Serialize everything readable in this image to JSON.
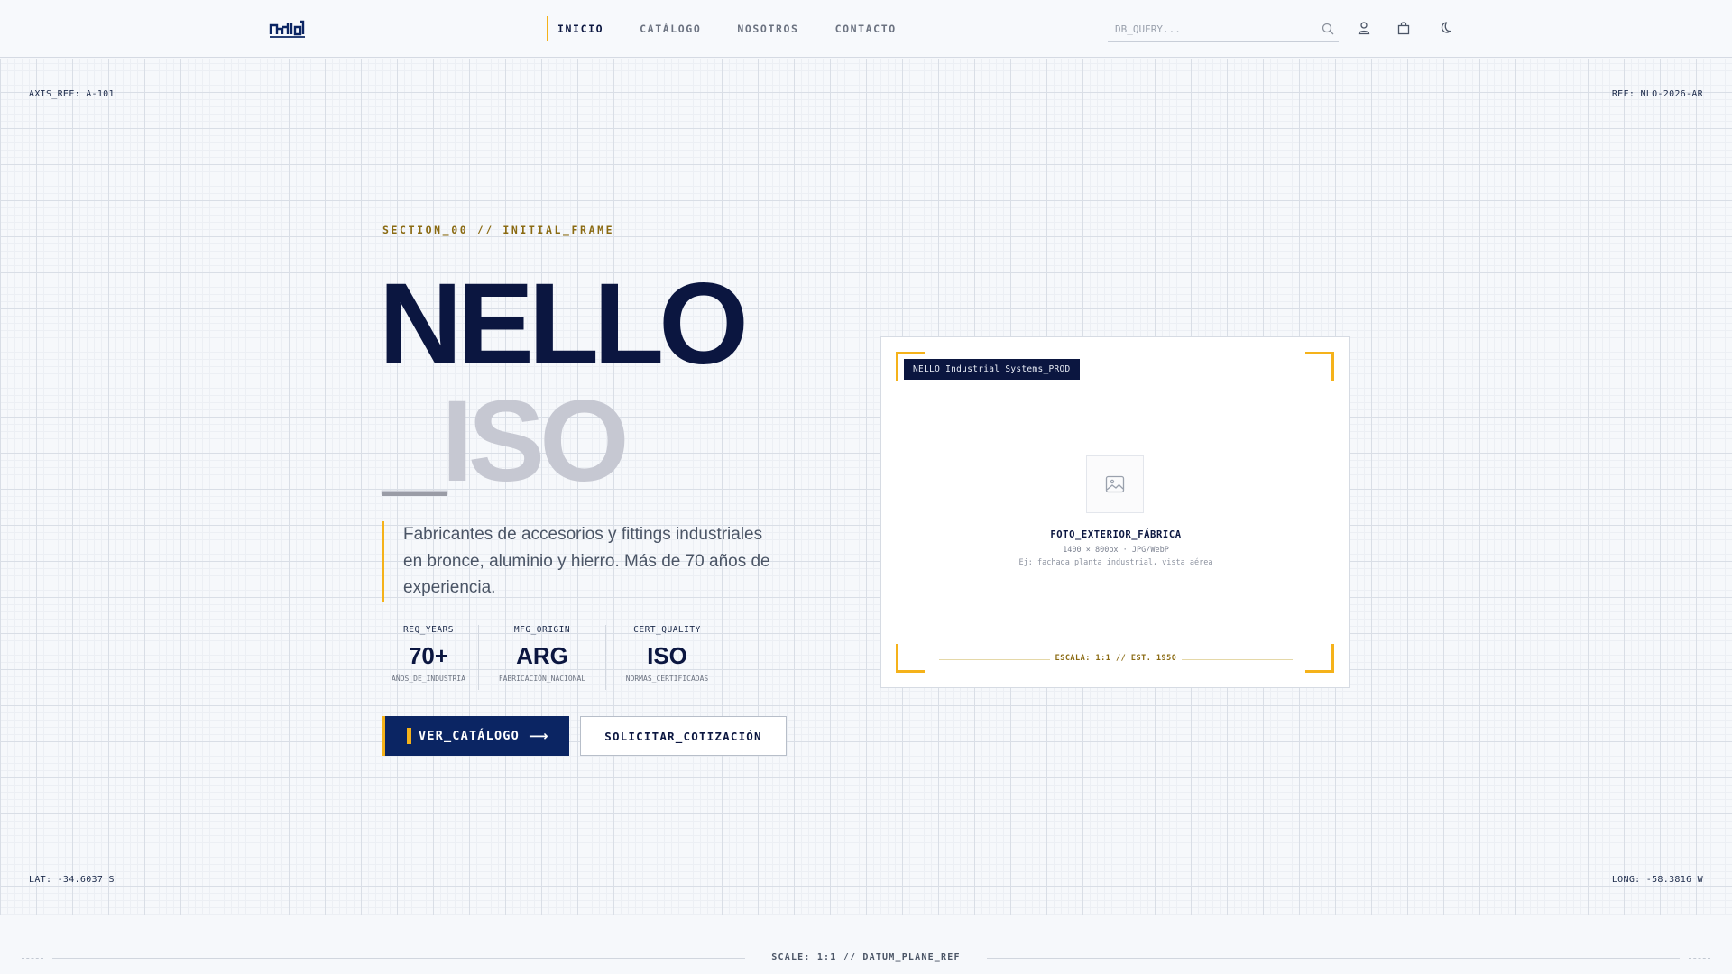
{
  "header": {
    "logo_alt": "nello",
    "nav": [
      {
        "label": "INICIO",
        "active": true
      },
      {
        "label": "CATÁLOGO",
        "active": false
      },
      {
        "label": "NOSOTROS",
        "active": false
      },
      {
        "label": "CONTACTO",
        "active": false
      }
    ],
    "search_placeholder": "DB_QUERY...",
    "icons": [
      "search-icon",
      "user-icon",
      "bag-icon",
      "moon-icon"
    ]
  },
  "grid_refs": {
    "top_left": "AXIS_REF: A-101",
    "top_right": "REF: NLO-2026-AR",
    "bottom_left": "LAT: -34.6037 S",
    "bottom_right": "LONG: -58.3816 W"
  },
  "hero": {
    "section_tag": "SECTION_00 // INITIAL_FRAME",
    "title_line1": "NELLO",
    "title_line2": "_ISO",
    "description": "Fabricantes de accesorios y fittings industriales en bronce, aluminio y hierro. Más de 70 años de experiencia.",
    "stats": [
      {
        "label": "REQ_YEARS",
        "value": "70+",
        "sub": "AÑOS_DE_INDUSTRIA"
      },
      {
        "label": "MFG_ORIGIN",
        "value": "ARG",
        "sub": "FABRICACIÓN_NACIONAL"
      },
      {
        "label": "CERT_QUALITY",
        "value": "ISO",
        "sub": "NORMAS_CERTIFICADAS"
      }
    ],
    "primary_button": "VER_CATÁLOGO",
    "secondary_button": "SOLICITAR_COTIZACIÓN"
  },
  "card": {
    "badge": "NELLO Industrial Systems_PROD",
    "placeholder_title": "FOTO_EXTERIOR_FÁBRICA",
    "placeholder_size": "1400 × 800px · JPG/WebP",
    "placeholder_example": "Ej: fachada planta industrial, vista aérea",
    "scale": "ESCALA: 1:1 // EST. 1950"
  },
  "footer": {
    "scale_ref": "SCALE: 1:1 // DATUM_PLANE_REF"
  },
  "colors": {
    "navy": "#0b1640",
    "button_navy": "#0b2563",
    "accent": "#f5b21a",
    "muted_title": "#c6c8d2",
    "background": "#f6f8fb"
  }
}
